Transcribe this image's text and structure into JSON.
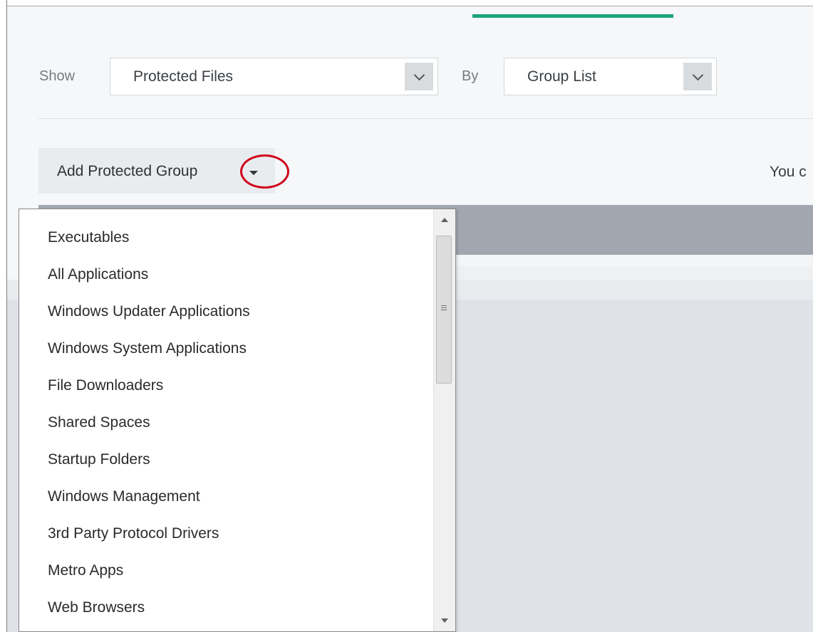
{
  "filter": {
    "show_label": "Show",
    "show_value": "Protected Files",
    "by_label": "By",
    "by_value": "Group List"
  },
  "toolbar": {
    "add_group_label": "Add Protected Group",
    "info_text_partial": "You c"
  },
  "dropdown": {
    "items": [
      "Executables",
      "All Applications",
      "Windows Updater Applications",
      "Windows System Applications",
      "File Downloaders",
      "Shared Spaces",
      "Startup Folders",
      "Windows Management",
      "3rd Party Protocol Drivers",
      "Metro Apps",
      "Web Browsers"
    ]
  },
  "icons": {
    "select_caret": "chevron-down-icon",
    "button_caret": "caret-down-icon",
    "annotation": "red-circle-highlight"
  },
  "colors": {
    "accent": "#1aa57c",
    "annotation": "#d0021b",
    "grid_header": "#a2a7af"
  }
}
